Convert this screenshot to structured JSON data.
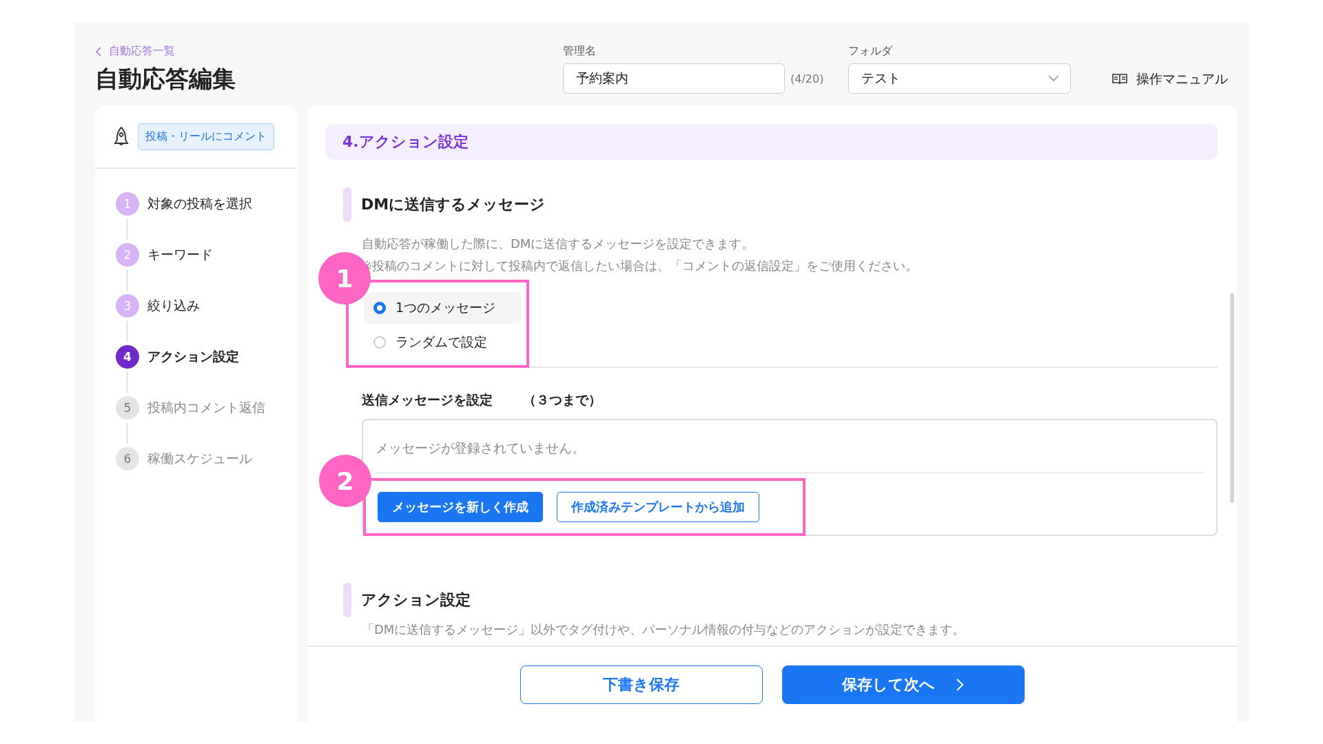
{
  "header": {
    "back_link": "自動応答一覧",
    "title": "自動応答編集",
    "name_field": {
      "label": "管理名",
      "value": "予約案内",
      "counter": "(4/20)"
    },
    "folder_select": {
      "label": "フォルダ",
      "value": "テスト"
    },
    "manual_link": "操作マニュアル"
  },
  "sidebar": {
    "trigger_tag": "投稿・リールにコメント",
    "steps": [
      {
        "number": "1",
        "label": "対象の投稿を選択",
        "completed": true,
        "selected": false
      },
      {
        "number": "2",
        "label": "キーワード",
        "completed": true,
        "selected": false
      },
      {
        "number": "3",
        "label": "絞り込み",
        "completed": true,
        "selected": false
      },
      {
        "number": "4",
        "label": "アクション設定",
        "completed": false,
        "selected": true
      },
      {
        "number": "5",
        "label": "投稿内コメント返信",
        "completed": false,
        "selected": false
      },
      {
        "number": "6",
        "label": "稼働スケジュール",
        "completed": false,
        "selected": false
      }
    ]
  },
  "main": {
    "section_title": "4.アクション設定",
    "dm_section": {
      "heading": "DMに送信するメッセージ",
      "description": [
        "自動応答が稼働した際に、DMに送信するメッセージを設定できます。",
        "※投稿のコメントに対して投稿内で返信したい場合は、「コメントの返信設定」をご使用ください。"
      ],
      "annotation": "1",
      "options": [
        {
          "label": "1つのメッセージ",
          "selected": true
        },
        {
          "label": "ランダムで設定",
          "selected": false
        }
      ]
    },
    "message_settings": {
      "label": "送信メッセージを設定",
      "limit": "（３つまで）",
      "empty_text": "メッセージが登録されていません。",
      "annotation": "2",
      "buttons": [
        {
          "label": "メッセージを新しく作成",
          "kind": "primary"
        },
        {
          "label": "作成済みテンプレートから追加",
          "kind": "outline"
        }
      ]
    },
    "action_section": {
      "heading": "アクション設定",
      "description": "「DMに送信するメッセージ」以外でタグ付けや、パーソナル情報の付与などのアクションが設定できます。"
    }
  },
  "footer": {
    "buttons": [
      {
        "label": "下書き保存",
        "kind": "outline"
      },
      {
        "label": "保存して次へ",
        "kind": "primary",
        "arrow": true
      }
    ]
  }
}
